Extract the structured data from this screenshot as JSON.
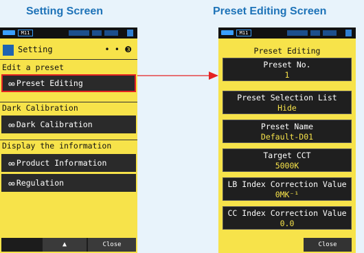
{
  "captions": {
    "left": "Setting Screen",
    "right": "Preset Editing Screen"
  },
  "status": {
    "memory": "M11"
  },
  "setting": {
    "title": "Setting",
    "page_indicator": "• • ❸",
    "sections": [
      {
        "label": "Edit a preset",
        "items": [
          "Preset Editing"
        ]
      },
      {
        "label": "Dark Calibration",
        "items": [
          "Dark Calibration"
        ]
      },
      {
        "label": "Display the information",
        "items": [
          "Product Information",
          "Regulation"
        ]
      }
    ],
    "up_button": "▲",
    "close_button": "Close"
  },
  "preset": {
    "title": "Preset Editing",
    "fields": [
      {
        "label": "Preset No.",
        "value": "1"
      },
      {
        "label": "Preset Selection List",
        "value": "Hide"
      },
      {
        "label": "Preset Name",
        "value": "Default-D01"
      },
      {
        "label": "Target CCT",
        "value": "5000K"
      },
      {
        "label": "LB Index Correction Value",
        "value": "0MK⁻¹"
      },
      {
        "label": "CC Index Correction Value",
        "value": "0.0"
      }
    ],
    "close_button": "Close"
  },
  "colors": {
    "screen_bg": "#f7e34a",
    "caption": "#1e73b8",
    "highlight": "#e52222"
  }
}
